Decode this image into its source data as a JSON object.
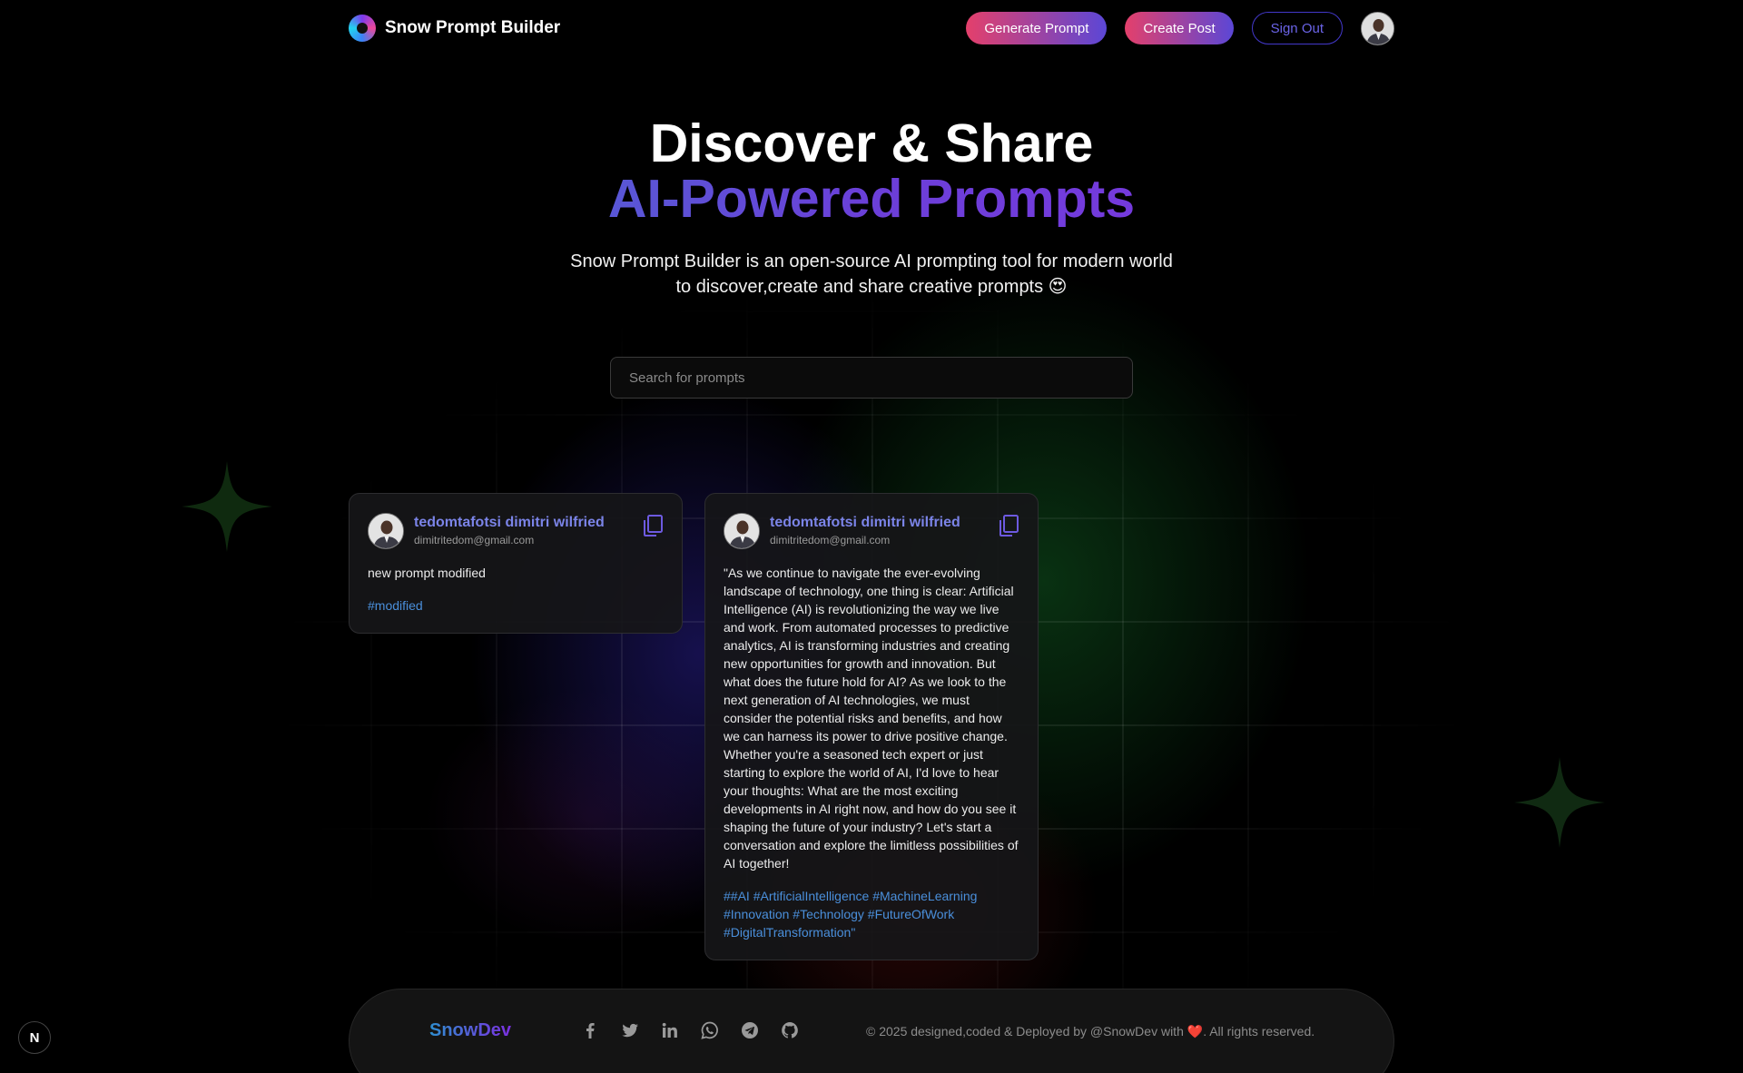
{
  "nav": {
    "brand": "Snow Prompt Builder",
    "generate_label": "Generate Prompt",
    "create_label": "Create Post",
    "signout_label": "Sign Out"
  },
  "hero": {
    "title_line1": "Discover & Share",
    "title_line2": "AI-Powered Prompts",
    "desc_line1": "Snow Prompt Builder is an open-source AI prompting tool for modern world",
    "desc_line2": "to discover,create and share creative prompts 😍"
  },
  "search": {
    "placeholder": "Search for prompts"
  },
  "posts": [
    {
      "name": "tedomtafotsi dimitri wilfried",
      "email": "dimitritedom@gmail.com",
      "prompt": "new prompt modified",
      "tag": "#modified"
    },
    {
      "name": "tedomtafotsi dimitri wilfried",
      "email": "dimitritedom@gmail.com",
      "prompt": "\"As we continue to navigate the ever-evolving landscape of technology, one thing is clear: Artificial Intelligence (AI) is revolutionizing the way we live and work. From automated processes to predictive analytics, AI is transforming industries and creating new opportunities for growth and innovation. But what does the future hold for AI? As we look to the next generation of AI technologies, we must consider the potential risks and benefits, and how we can harness its power to drive positive change. Whether you're a seasoned tech expert or just starting to explore the world of AI, I'd love to hear your thoughts: What are the most exciting developments in AI right now, and how do you see it shaping the future of your industry? Let's start a conversation and explore the limitless possibilities of AI together!",
      "tag": "##AI #ArtificialIntelligence #MachineLearning #Innovation #Technology #FutureOfWork #DigitalTransformation\""
    }
  ],
  "footer": {
    "brand": "SnowDev",
    "copyright_pre": "© 2025 designed,coded & Deployed by @SnowDev with ",
    "heart": "❤️",
    "copyright_post": ". All rights reserved."
  },
  "badge": {
    "letter": "N"
  },
  "icons": {
    "socials": [
      "facebook-icon",
      "twitter-icon",
      "linkedin-icon",
      "whatsapp-icon",
      "telegram-icon",
      "github-icon"
    ],
    "copy": "copy-icon"
  },
  "colors": {
    "accent_gradient_start": "#e4406b",
    "accent_gradient_end": "#5b47d6",
    "creator_name": "#7b84e8",
    "tag": "#4a8fdb",
    "outline_button": "#4338ca"
  }
}
